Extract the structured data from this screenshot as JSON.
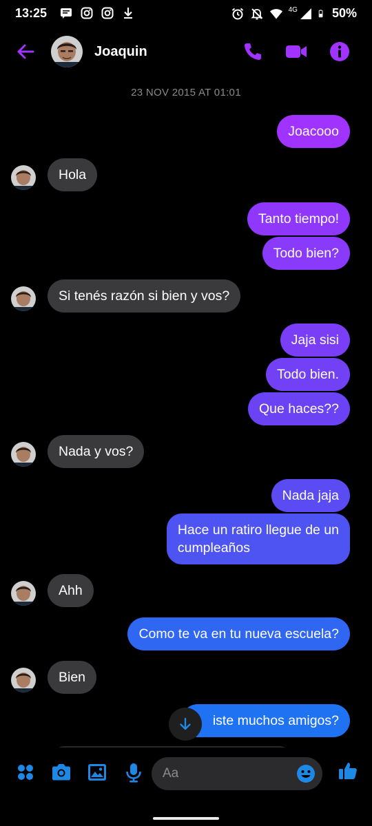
{
  "status_bar": {
    "time": "13:25",
    "network": "4G",
    "battery": "50%",
    "left_icons": [
      "messages-notification-icon",
      "instagram-icon",
      "instagram-icon",
      "download-icon"
    ],
    "right_icons": [
      "alarm-icon",
      "notifications-off-icon",
      "wifi-icon",
      "signal-icon",
      "battery-icon"
    ]
  },
  "header": {
    "contact_name": "Joaquin",
    "accent_color": "#A033FF",
    "icons": [
      "back-arrow-icon",
      "phone-icon",
      "video-camera-icon",
      "info-icon"
    ]
  },
  "chat": {
    "timestamp": "23 NOV 2015 AT 01:01",
    "messages": [
      {
        "from": "me",
        "text": "Joacooo"
      },
      {
        "from": "them",
        "text": "Hola"
      },
      {
        "from": "me",
        "text": "Tanto tiempo!"
      },
      {
        "from": "me",
        "text": "Todo bien?"
      },
      {
        "from": "them",
        "text": "Si tenés razón si bien y vos?"
      },
      {
        "from": "me",
        "text": "Jaja sisi"
      },
      {
        "from": "me",
        "text": "Todo bien."
      },
      {
        "from": "me",
        "text": "Que haces??"
      },
      {
        "from": "them",
        "text": "Nada y vos?"
      },
      {
        "from": "me",
        "text": "Nada jaja"
      },
      {
        "from": "me",
        "text": "Hace un ratiro llegue de un",
        "text2": "cumpleaños"
      },
      {
        "from": "them",
        "text": "Ahh"
      },
      {
        "from": "me",
        "text": "Como te va en tu nueva escuela?"
      },
      {
        "from": "them",
        "text": "Bien"
      },
      {
        "from": "me",
        "text": "iste muchos amigos?"
      }
    ],
    "outgoing_colors": {
      "top": "#A033FF",
      "mid": "#6B48F0",
      "bottom": "#1F72F2"
    },
    "incoming_color": "#3A3A3C"
  },
  "composer": {
    "placeholder": "Aa",
    "accent_color": "#1E88E5",
    "icons": [
      "apps-icon",
      "camera-icon",
      "gallery-icon",
      "microphone-icon",
      "emoji-icon",
      "thumbs-up-icon"
    ]
  }
}
